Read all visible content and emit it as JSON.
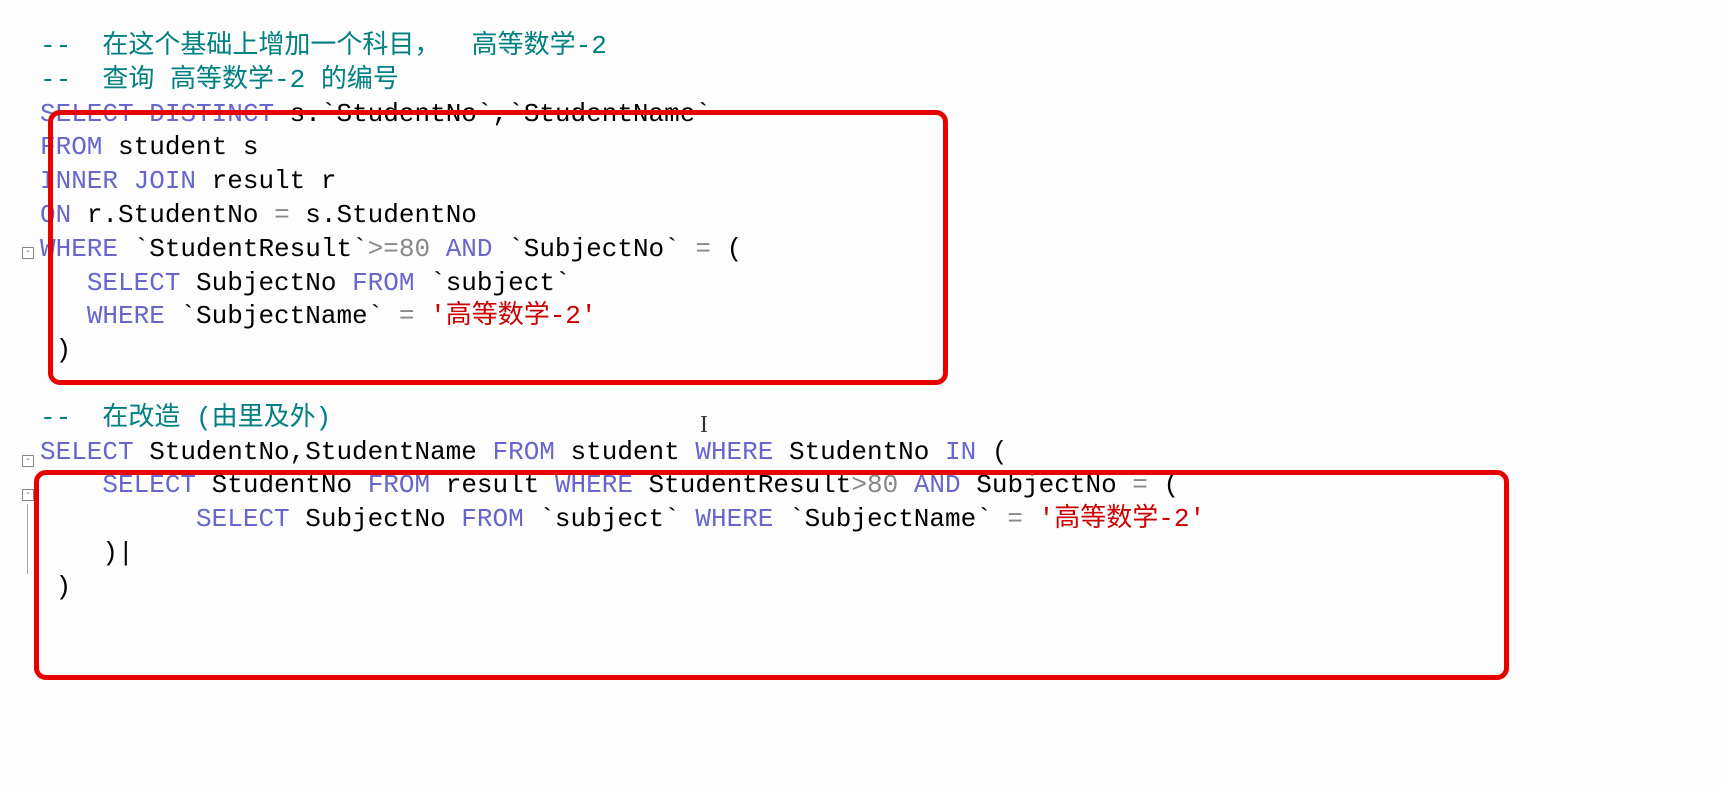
{
  "lines": {
    "l1": {
      "comment_prefix": "--  ",
      "comment_text": "在这个基础上增加一个科目，  高等数学-2"
    },
    "l2": {
      "comment_prefix": "--  ",
      "comment_text": "查询 高等数学-2 的编号"
    },
    "l3": {
      "kw_select": "SELECT",
      "kw_distinct": "DISTINCT",
      "col1": " s.`StudentNo`,`StudentName`"
    },
    "l4": {
      "kw_from": "FROM",
      "text": " student s"
    },
    "l5": {
      "kw_inner": "INNER",
      "kw_join": "JOIN",
      "text": " result r"
    },
    "l6": {
      "kw_on": "ON",
      "text": " r.StudentNo ",
      "op": "=",
      "text2": " s.StudentNo"
    },
    "l7": {
      "kw_where": "WHERE",
      "text1": " `StudentResult`",
      "op1": ">=",
      "num": "80",
      "kw_and": "AND",
      "text2": " `SubjectNo` ",
      "op2": "=",
      "paren": " ("
    },
    "l8": {
      "indent": "   ",
      "kw_select": "SELECT",
      "text1": " SubjectNo ",
      "kw_from": "FROM",
      "text2": " `subject`"
    },
    "l9": {
      "indent": "   ",
      "kw_where": "WHERE",
      "text1": " `SubjectName` ",
      "op": "=",
      "space": " ",
      "str": "'高等数学-2'"
    },
    "l10": {
      "indent": " ",
      "paren": ")"
    },
    "l11": {
      "empty": " "
    },
    "l12": {
      "comment_prefix": "--  ",
      "comment_text": "在改造 (由里及外)"
    },
    "l13": {
      "kw_select": "SELECT",
      "text1": " StudentNo,StudentName ",
      "kw_from": "FROM",
      "text2": " student ",
      "kw_where": "WHERE",
      "text3": " StudentNo ",
      "kw_in": "IN",
      "paren": " ("
    },
    "l14": {
      "indent": "    ",
      "kw_select": "SELECT",
      "text1": " StudentNo ",
      "kw_from": "FROM",
      "text2": " result ",
      "kw_where": "WHERE",
      "text3": " StudentResult",
      "op1": ">",
      "num": "80",
      "kw_and": "AND",
      "text4": " SubjectNo ",
      "op2": "=",
      "paren": " ("
    },
    "l15": {
      "indent": "          ",
      "kw_select": "SELECT",
      "text1": " SubjectNo ",
      "kw_from": "FROM",
      "text2": " `subject` ",
      "kw_where": "WHERE",
      "text3": " `SubjectName` ",
      "op": "=",
      "space": " ",
      "str": "'高等数学-2'"
    },
    "l16": {
      "indent": "    ",
      "paren": ")",
      "cursor": "|"
    },
    "l17": {
      "indent": " ",
      "paren": ")"
    }
  },
  "cursor_glyph": "I"
}
